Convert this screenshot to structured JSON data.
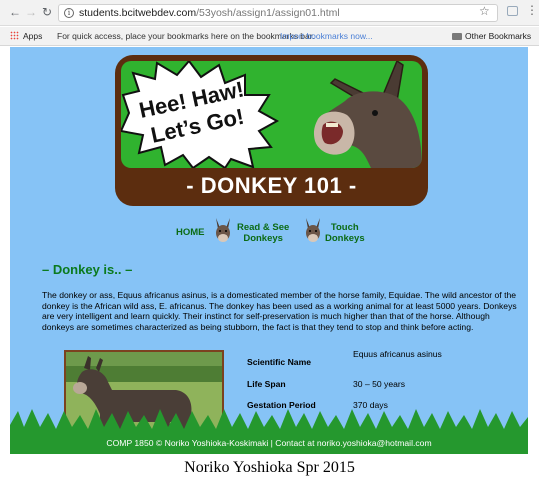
{
  "browser": {
    "back_icon": "arrow-left-icon",
    "forward_icon": "arrow-right-icon",
    "reload_icon": "reload-icon",
    "url_host": "students.bcitwebdev.com",
    "url_path": "/53yosh/assign1/assign01.html",
    "bookmark_star_icon": "star-icon",
    "menu_icon": "kebab-icon"
  },
  "bookmarks_bar": {
    "apps_label": "Apps",
    "hint": "For quick access, place your bookmarks here on the bookmarks bar.",
    "import_link": "Import bookmarks now...",
    "other_label": "Other Bookmarks"
  },
  "banner": {
    "burst_line1": "Hee! Haw!",
    "burst_line2": "Let’s Go!",
    "title": "- DONKEY 101 -"
  },
  "nav": {
    "home": "HOME",
    "read_line1": "Read & See",
    "read_line2": "Donkeys",
    "touch_line1": "Touch",
    "touch_line2": "Donkeys"
  },
  "section": {
    "heading": "– Donkey is.. –",
    "intro": "The donkey or ass, Equus africanus asinus, is a domesticated member of the horse family, Equidae. The wild ancestor of the donkey is the African wild ass, E. africanus. The donkey has been used as a working animal for at least 5000 years. Donkeys are very intelligent and learn quickly. Their instinct for self-preservation is much higher than that of the horse. Although donkeys are sometimes characterized as being stubborn, the fact is that they tend to stop and think before acting."
  },
  "facts": [
    {
      "label": "Scientific Name",
      "value": "Equus africanus asinus"
    },
    {
      "label": "Life Span",
      "value": "30 – 50 years"
    },
    {
      "label": "Gestation Period",
      "value": "370 days"
    }
  ],
  "footer": "COMP 1850 © Noriko Yoshioka-Koskimaki | Contact at noriko.yoshioka@hotmail.com",
  "credit": "Noriko Yoshioka Spr 2015",
  "colors": {
    "page_bg": "#86c3f6",
    "banner_frame": "#5c2d0f",
    "banner_green": "#30b32f",
    "nav_text": "#0b6b15",
    "footer_bg": "#25982e"
  }
}
